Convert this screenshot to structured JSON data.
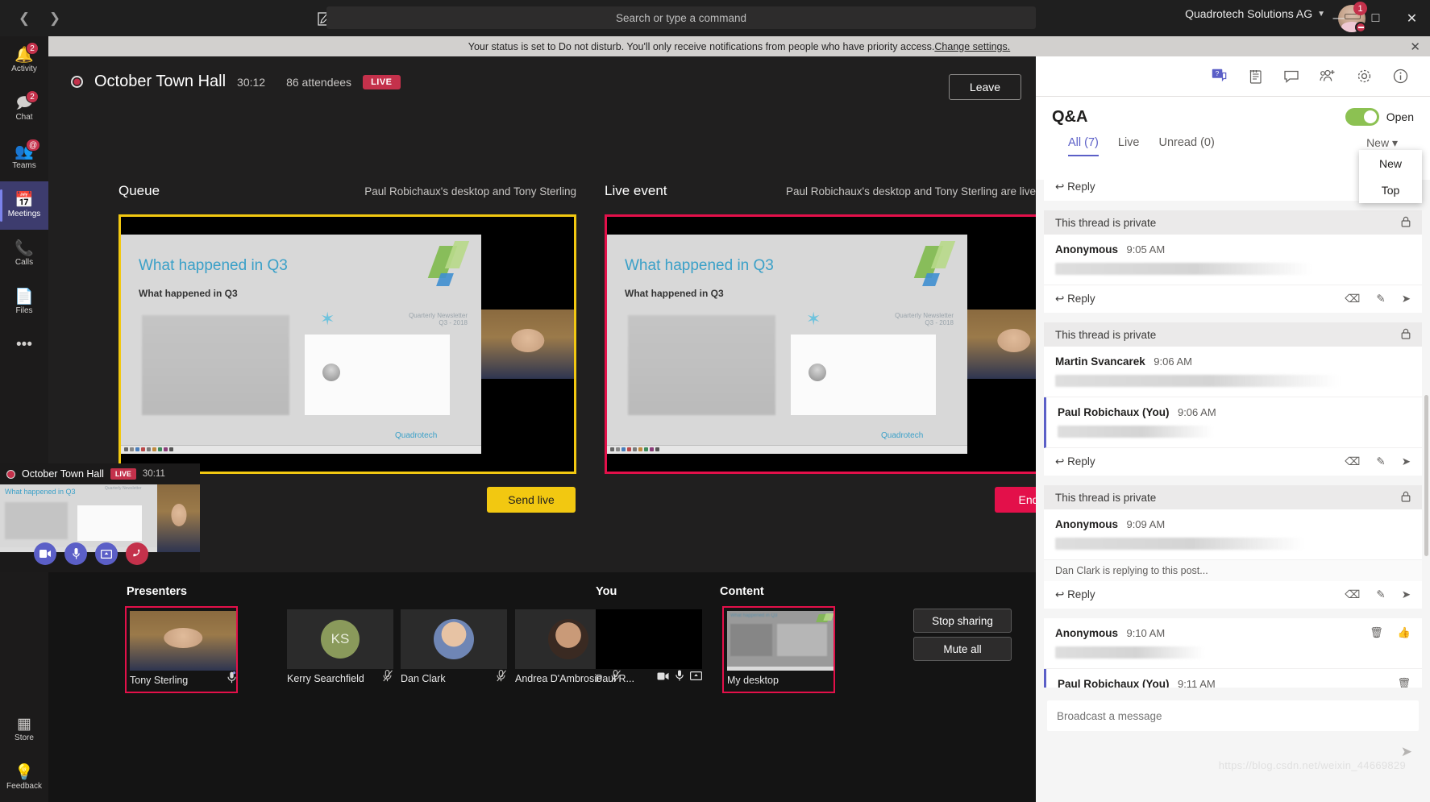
{
  "titlebar": {
    "back_icon": "chevron-left-icon",
    "forward_icon": "chevron-right-icon",
    "compose_icon": "compose-icon",
    "search_placeholder": "Search or type a command",
    "org_name": "Quadrotech Solutions AG",
    "org_badge": "1",
    "minimize": "—",
    "maximize": "□",
    "close": "✕"
  },
  "status_banner": {
    "text": "Your status is set to Do not disturb. You'll only receive notifications from people who have priority access. ",
    "link": "Change settings.",
    "close_icon": "close-icon"
  },
  "rail": {
    "items": [
      {
        "label": "Activity",
        "icon": "bell-icon",
        "badge": "2"
      },
      {
        "label": "Chat",
        "icon": "chat-icon",
        "badge": "2"
      },
      {
        "label": "Teams",
        "icon": "teams-icon",
        "badge": "@"
      },
      {
        "label": "Meetings",
        "icon": "calendar-icon",
        "badge": ""
      },
      {
        "label": "Calls",
        "icon": "phone-icon",
        "badge": ""
      },
      {
        "label": "Files",
        "icon": "files-icon",
        "badge": ""
      }
    ],
    "more": "•••",
    "bottom": [
      {
        "label": "Store",
        "icon": "store-icon"
      },
      {
        "label": "Feedback",
        "icon": "lightbulb-icon"
      }
    ]
  },
  "meeting": {
    "title": "October Town Hall",
    "timer": "30:12",
    "attendees": "86 attendees",
    "live_badge": "LIVE",
    "leave_label": "Leave",
    "record_icon": "record-icon"
  },
  "queue": {
    "label": "Queue",
    "source": "Paul Robichaux's desktop and Tony Sterling",
    "send_live_label": "Send live"
  },
  "live_event": {
    "label": "Live event",
    "source": "Paul Robichaux's desktop and Tony Sterling are live",
    "end_label": "End"
  },
  "slide": {
    "title": "What happened in Q3",
    "subtitle": "What happened in Q3",
    "newsletter_line1": "Quarterly Newsletter",
    "newsletter_line2": "Q3 - 2018",
    "brand": "Quadrotech"
  },
  "pip": {
    "title": "October Town Hall",
    "live_badge": "LIVE",
    "timer": "30:11",
    "slide_title": "What happened in Q3",
    "controls": [
      {
        "name": "camera-button",
        "icon": "■"
      },
      {
        "name": "mic-button",
        "icon": "☰"
      },
      {
        "name": "share-button",
        "icon": "⬚"
      },
      {
        "name": "hangup-button",
        "icon": "☎"
      }
    ]
  },
  "tray": {
    "presenters_label": "Presenters",
    "you_label": "You",
    "content_label": "Content",
    "presenters": [
      {
        "name": "Tony Sterling",
        "mic": "mic-on-icon",
        "selected": true,
        "avatar_type": "video"
      },
      {
        "name": "Kerry Searchfield",
        "mic": "mic-off-icon",
        "selected": false,
        "avatar_type": "initials",
        "initials": "KS"
      },
      {
        "name": "Dan Clark",
        "mic": "mic-off-icon",
        "selected": false,
        "avatar_type": "photo-dan"
      },
      {
        "name": "Andrea D'Ambrosio",
        "mic": "mic-off-icon",
        "selected": false,
        "avatar_type": "photo-andrea"
      }
    ],
    "you": {
      "name": "Paul R...",
      "camera_icon": "camera-icon",
      "mic_icon": "mic-icon",
      "share_icon": "screen-share-icon"
    },
    "content": {
      "name": "My desktop"
    },
    "stop_sharing_label": "Stop sharing",
    "mute_all_label": "Mute all"
  },
  "qa": {
    "icons": [
      {
        "name": "qa-icon",
        "glyph": "?",
        "active": true
      },
      {
        "name": "notes-icon",
        "glyph": "☷",
        "active": false
      },
      {
        "name": "chat-icon",
        "glyph": "☷",
        "active": false
      },
      {
        "name": "add-people-icon",
        "glyph": "☷",
        "active": false
      },
      {
        "name": "settings-gear-icon",
        "glyph": "⚙",
        "active": false
      },
      {
        "name": "info-icon",
        "glyph": "ⓘ",
        "active": false
      }
    ],
    "title": "Q&A",
    "toggle_label": "Open",
    "toggle_on": true,
    "tabs": [
      {
        "label": "All (7)",
        "active": true
      },
      {
        "label": "Live",
        "active": false
      },
      {
        "label": "Unread (0)",
        "active": false
      }
    ],
    "sort_label": "New",
    "sort_options": [
      "New",
      "Top"
    ],
    "private_label": "This thread is private",
    "reply_label": "Reply",
    "typing_notice": "Dan Clark is replying to this post...",
    "threads": [
      {
        "private": true,
        "posts": [
          {
            "author": "Anonymous",
            "time": "9:05 AM",
            "mine": false
          }
        ],
        "has_reply_bar": true
      },
      {
        "private": true,
        "posts": [
          {
            "author": "Martin Svancarek",
            "time": "9:06 AM",
            "mine": false
          },
          {
            "author": "Paul Robichaux (You)",
            "time": "9:06 AM",
            "mine": true
          }
        ],
        "has_reply_bar": true
      },
      {
        "private": true,
        "posts": [
          {
            "author": "Anonymous",
            "time": "9:09 AM",
            "mine": false
          }
        ],
        "typing": true,
        "has_reply_bar": true
      },
      {
        "private": false,
        "posts": [
          {
            "author": "Anonymous",
            "time": "9:10 AM",
            "mine": false,
            "actions": [
              "delete-icon",
              "like-icon"
            ]
          },
          {
            "author": "Paul Robichaux (You)",
            "time": "9:11 AM",
            "mine": true,
            "actions": [
              "delete-icon"
            ]
          }
        ],
        "has_reply_bar": false
      }
    ],
    "compose_placeholder": "Broadcast a message",
    "send_icon": "send-icon"
  },
  "watermark": "https://blog.csdn.net/weixin_44669829"
}
